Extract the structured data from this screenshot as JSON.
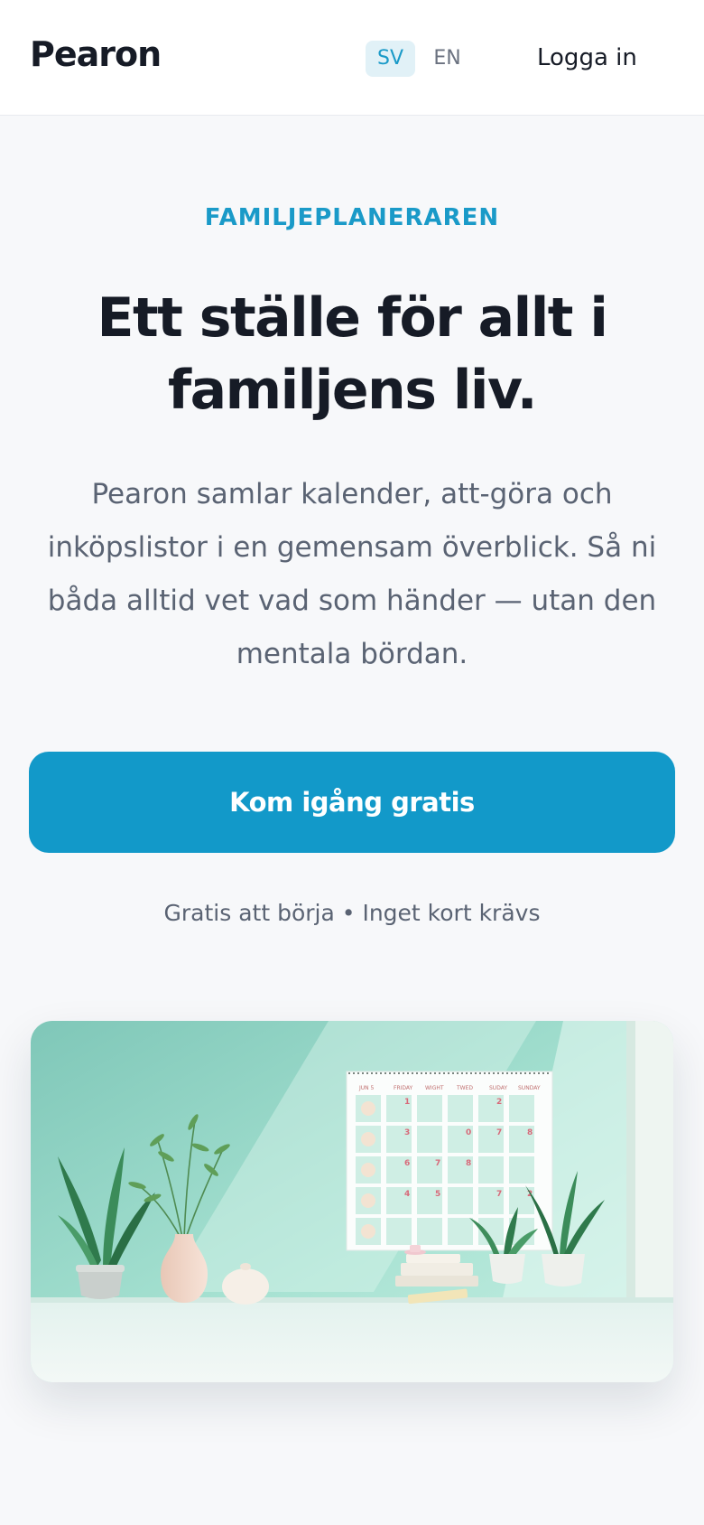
{
  "header": {
    "logo": "Pearon",
    "languages": [
      {
        "code": "SV",
        "active": true
      },
      {
        "code": "EN",
        "active": false
      }
    ],
    "login_label": "Logga in"
  },
  "hero": {
    "eyebrow": "FAMILJEPLANERAREN",
    "title": "Ett ställe för allt i familjens liv.",
    "subtitle": "Pearon samlar kalender, att-göra och inköpslistor i en gemensam överblick. Så ni båda alltid vet vad som händer — utan den mentala bördan.",
    "cta_label": "Kom igång gratis",
    "fineprint": "Gratis att börja • Inget kort krävs"
  },
  "illustration": {
    "calendar_headers": [
      "JUN 5",
      "FRIDAY",
      "WIGHT",
      "TWED",
      "SUDAY",
      "SUNDAY"
    ],
    "calendar_numbers": [
      "1",
      "2",
      "3",
      "0",
      "7",
      "8",
      "6",
      "7",
      "8",
      "4",
      "5",
      "7",
      "2"
    ]
  },
  "colors": {
    "accent": "#1299c9",
    "accent_soft": "#e1f1f7",
    "text_dark": "#161b26",
    "text_muted": "#5a6373",
    "background": "#f7f8fa"
  }
}
